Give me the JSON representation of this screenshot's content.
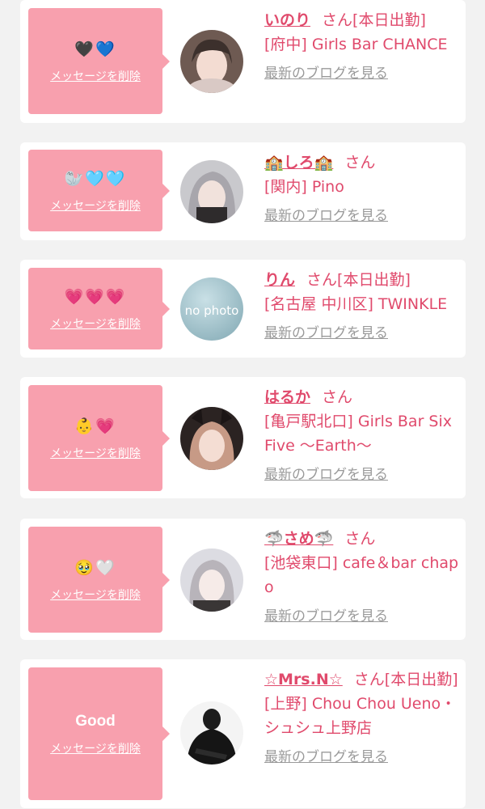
{
  "delete_label": "メッセージを削除",
  "blog_label": "最新のブログを見る",
  "san": "さん",
  "colors": {
    "bubble": "#f8a0ae",
    "accent": "#e04a6c",
    "muted": "#9a9a9a",
    "background": "#f2f2f2"
  },
  "cards": [
    {
      "message": "🖤💙",
      "name": "いのり",
      "status": "[本日出勤]",
      "shop": "[府中] Girls Bar CHANCE",
      "avatar": "photo-avatar"
    },
    {
      "message": "🦭🩵🩵",
      "name": "🏫しろ🏫",
      "status": "",
      "shop": "[関内] Pino",
      "avatar": "photo-avatar"
    },
    {
      "message": "💗💗💗",
      "name": "りん",
      "status": "[本日出勤]",
      "shop": "[名古屋 中川区] TWINKLE",
      "avatar": "no-photo-avatar",
      "avatar_text": "no photo"
    },
    {
      "message": "👶💗",
      "name": "はるか",
      "status": "",
      "shop": "[亀戸駅北口] Girls Bar Six Five 〜Earth〜",
      "avatar": "photo-avatar"
    },
    {
      "message": "🥹🤍",
      "name": "🦈さめ🦈",
      "status": "",
      "shop": "[池袋東口] cafe＆bar chapo",
      "avatar": "photo-avatar"
    },
    {
      "message": "Good",
      "name": "☆Mrs.N☆",
      "status": "[本日出勤]",
      "shop": "[上野] Chou Chou Ueno・シュシュ上野店",
      "avatar": "photo-avatar"
    }
  ]
}
